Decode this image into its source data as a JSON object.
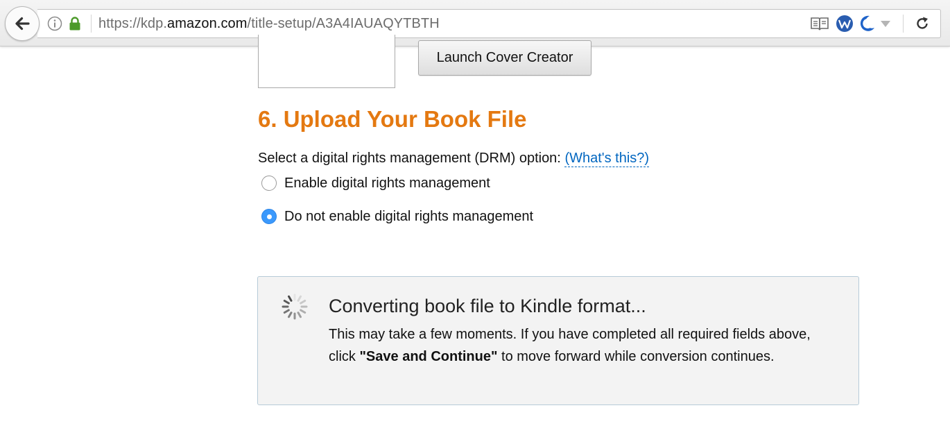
{
  "browser": {
    "url_prefix": "https://kdp.",
    "url_domain": "amazon.com",
    "url_path": "/title-setup/A3A4IAUAQYTBTH",
    "icons": [
      "back-arrow-icon",
      "info-icon",
      "lock-icon",
      "reader-view-icon",
      "extension-w-icon",
      "extension-moon-icon",
      "chevron-down-icon",
      "reload-icon"
    ],
    "lock_color": "#4c9a2a"
  },
  "cover": {
    "launch_button_label": "Launch Cover Creator"
  },
  "section": {
    "title": "6. Upload Your Book File",
    "title_color": "#e47911"
  },
  "drm": {
    "prompt": "Select a digital rights management (DRM) option:",
    "help_link": "(What's this?)",
    "options": [
      {
        "label": "Enable digital rights management",
        "selected": false
      },
      {
        "label": "Do not enable digital rights management",
        "selected": true
      }
    ]
  },
  "conversion": {
    "title": "Converting book file to Kindle format...",
    "body_before": "This may take a few moments. If you have completed all required fields above, click ",
    "body_bold": "\"Save and Continue\"",
    "body_after": " to move forward while conversion continues.",
    "icon": "loading-spinner-icon"
  }
}
